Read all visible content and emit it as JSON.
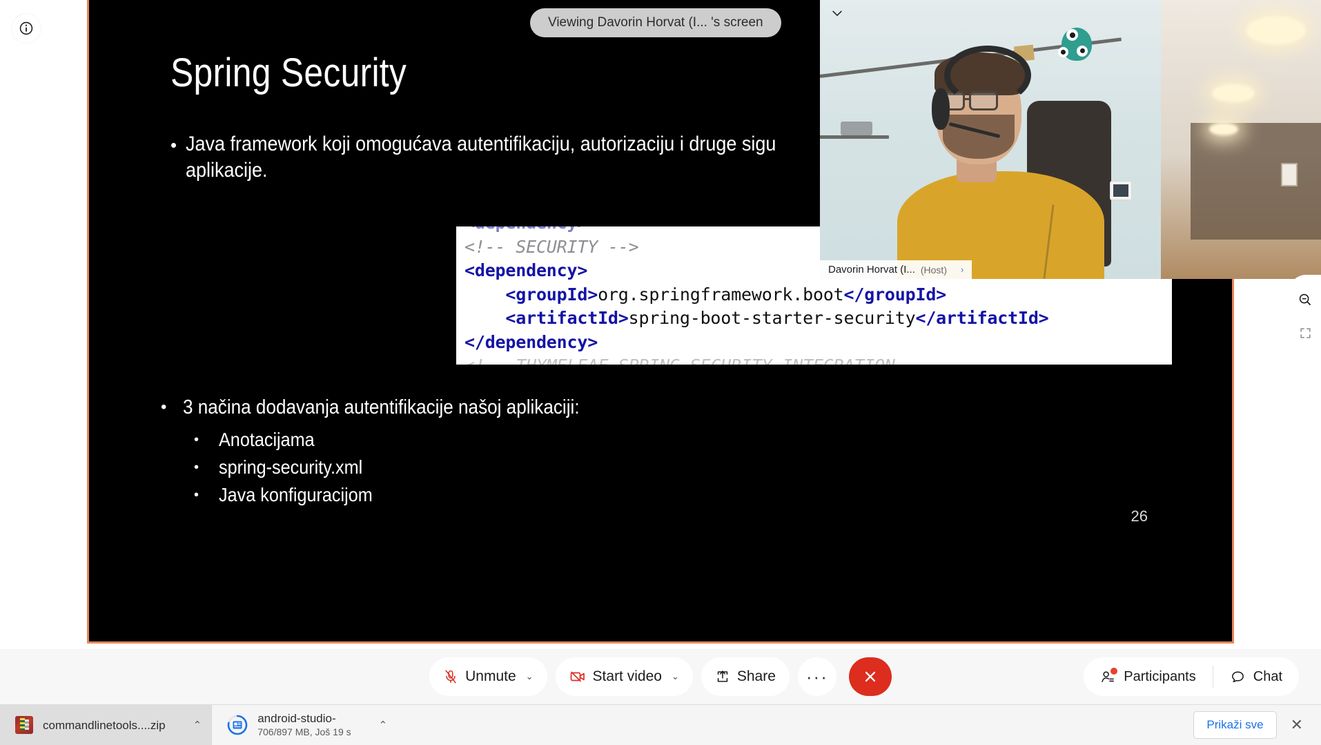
{
  "share": {
    "viewing_banner": "Viewing Davorin Horvat (I... 's screen",
    "info_icon": "info-icon",
    "border_color": "#e2875a"
  },
  "right_controls": [
    {
      "icon": "zoom-out-icon",
      "name": "zoom-out-button"
    },
    {
      "icon": "fullscreen-icon",
      "name": "fullscreen-button"
    }
  ],
  "slide": {
    "title": "Spring Security",
    "page_number": "26",
    "background_color": "#000000",
    "text_color": "#ffffff",
    "bullet_1": {
      "line1": "Java framework koji omogućava autentifikaciju, autorizaciju i druge sigu",
      "line2": "aplikacije."
    },
    "bullet_2": {
      "text": "3 načina dodavanja autentifikacije našoj aplikaciji:",
      "sub_items": [
        "Anotacijama",
        "spring-security.xml",
        "Java konfiguracijom"
      ]
    },
    "code_block": {
      "lines": [
        {
          "text": "<dependency>",
          "kind": "clipped-top"
        },
        {
          "text": "<!-- SECURITY -->",
          "kind": "comment"
        },
        {
          "text": "<dependency>",
          "kind": "tag"
        },
        {
          "text": "    <groupId>org.springframework.boot</groupId>",
          "kind": "mixed"
        },
        {
          "text": "    <artifactId>spring-boot-starter-security</artifactId>",
          "kind": "mixed"
        },
        {
          "text": "</dependency>",
          "kind": "tag"
        },
        {
          "text": "<!-- THYMELEAF SPRING SECURITY INTEGRATION",
          "kind": "clipped-bottom"
        }
      ],
      "tag_color": "#1414a5",
      "comment_color": "#8e8e93",
      "background": "#ffffff"
    }
  },
  "video": {
    "participant_name": "Davorin Horvat (I...",
    "host_label": "(Host)",
    "arrow": "›",
    "collapse_icon": "chevron-down-icon"
  },
  "toolbar": {
    "buttons": [
      {
        "label": "Unmute",
        "icon": "microphone-muted-icon",
        "has_caret": true
      },
      {
        "label": "Start video",
        "icon": "video-off-icon",
        "has_caret": true
      },
      {
        "label": "Share",
        "icon": "share-screen-icon",
        "has_caret": false
      }
    ],
    "more_label": "···",
    "more_icon": "more-options-icon",
    "end_icon": "end-call-icon",
    "end_color": "#dc2d1e",
    "right": [
      {
        "label": "Participants",
        "icon": "participants-icon",
        "has_badge": true
      },
      {
        "label": "Chat",
        "icon": "chat-icon",
        "has_badge": false
      }
    ]
  },
  "downloads": {
    "items": [
      {
        "title": "commandlinetools....zip",
        "subtitle": "",
        "icon": "zip-archive-icon",
        "active": true,
        "caret": "⌃"
      },
      {
        "title": "android-studio-",
        "subtitle": "706/897 MB, Još 19 s",
        "icon": "download-progress-icon",
        "active": false,
        "caret": "⌃"
      }
    ],
    "show_all_label": "Prikaži sve",
    "close_icon": "close-icon"
  }
}
